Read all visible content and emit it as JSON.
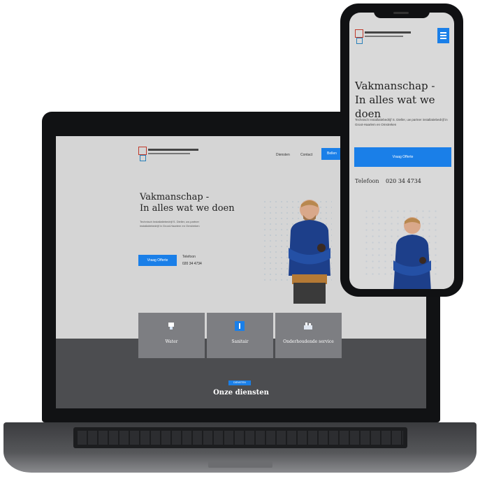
{
  "laptop_site": {
    "nav_items": [
      "Diensten",
      "Contact"
    ],
    "nav_button": "Bellen",
    "hero_title_line1": "Vakmanschap -",
    "hero_title_line2": "In alles wat we doen",
    "hero_subtitle": "Technisch Installatiebedrijf S. Dieller, uw partner installatiebedrijf in Groot-Haarlem en Omstreken",
    "cta_button": "Vraag Offerte",
    "phone_label": "Telefoon",
    "phone_number": "020 34 4734",
    "service_cards": [
      "Water",
      "Sanitair",
      "Onderhoudende service"
    ],
    "section_badge": "DIENSTEN",
    "section_title": "Onze diensten"
  },
  "phone_site": {
    "hero_title_line1": "Vakmanschap -",
    "hero_title_line2": "In alles wat we doen",
    "hero_subtitle": "Technisch Installatiebedrijf S. Dieller, uw partner installatiebedrijf in Groot-Haarlem en Omstreken",
    "cta_button": "Vraag Offerte",
    "phone_label": "Telefoon",
    "phone_number": "020 34 4734"
  },
  "colors": {
    "accent": "#1a7fe8",
    "device_frame": "#111214",
    "screen_bg": "#d5d5d5",
    "dark_section": "#4c4d50",
    "card_bg": "#7d7e82"
  },
  "icons": [
    "hamburger-icon",
    "water-drop-icon",
    "sanitair-icon",
    "service-tools-icon"
  ]
}
